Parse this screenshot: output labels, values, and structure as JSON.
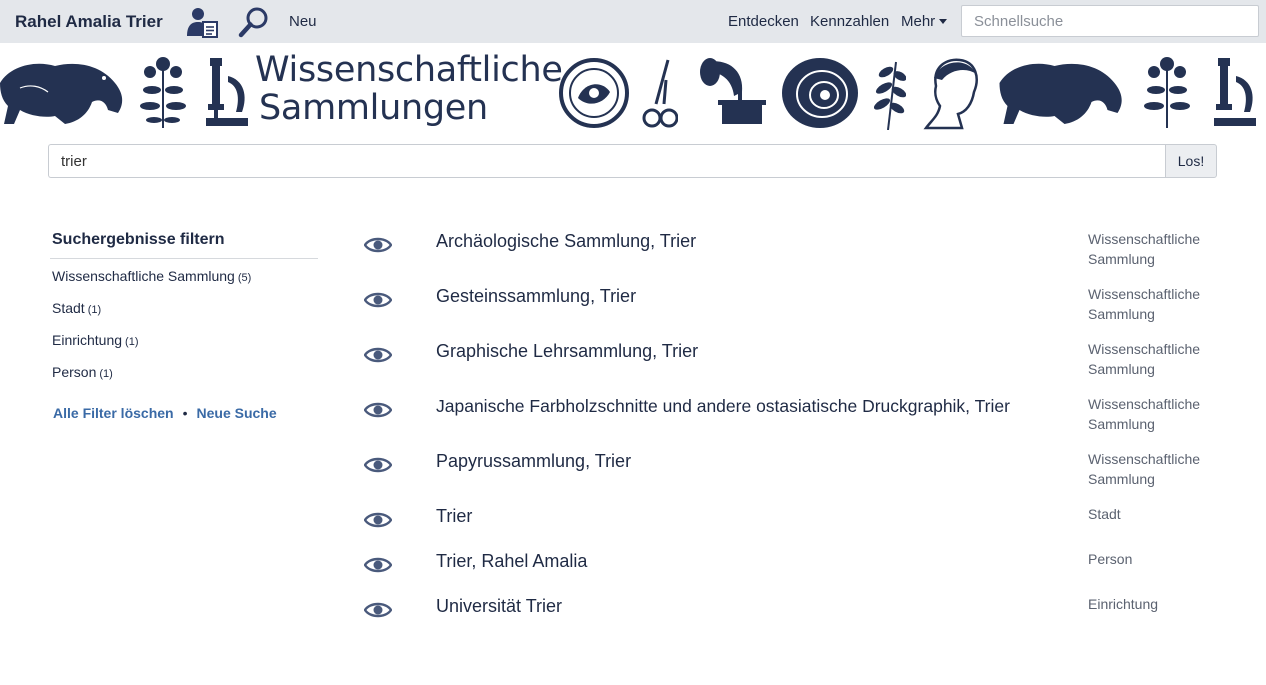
{
  "navbar": {
    "brand": "Rahel Amalia Trier",
    "neu": "Neu",
    "entdecken": "Entdecken",
    "kennzahlen": "Kennzahlen",
    "mehr": "Mehr",
    "quick_search_placeholder": "Schnellsuche"
  },
  "banner": {
    "title_line1": "Wissenschaftliche",
    "title_line2": "Sammlungen"
  },
  "search": {
    "value": "trier",
    "button": "Los!"
  },
  "sidebar": {
    "title": "Suchergebnisse filtern",
    "facets": [
      {
        "label": "Wissenschaftliche Sammlung",
        "count": "(5)"
      },
      {
        "label": "Stadt",
        "count": "(1)"
      },
      {
        "label": "Einrichtung",
        "count": "(1)"
      },
      {
        "label": "Person",
        "count": "(1)"
      }
    ],
    "clear_filters": "Alle Filter löschen",
    "separator": "•",
    "new_search": "Neue Suche"
  },
  "results": [
    {
      "title": "Archäologische Sammlung, Trier",
      "type": "Wissenschaftliche Sammlung"
    },
    {
      "title": "Gesteinssammlung, Trier",
      "type": "Wissenschaftliche Sammlung"
    },
    {
      "title": "Graphische Lehrsammlung, Trier",
      "type": "Wissenschaftliche Sammlung"
    },
    {
      "title": "Japanische Farbholzschnitte und andere ostasiatische Druckgraphik, Trier",
      "type": "Wissenschaftliche Sammlung"
    },
    {
      "title": "Papyrussammlung, Trier",
      "type": "Wissenschaftliche Sammlung"
    },
    {
      "title": "Trier",
      "type": "Stadt"
    },
    {
      "title": "Trier, Rahel Amalia",
      "type": "Person"
    },
    {
      "title": "Universität Trier",
      "type": "Einrichtung"
    }
  ],
  "colors": {
    "navy": "#1f2a44",
    "link": "#3a6aa6",
    "navbar_bg": "#e4e7eb",
    "eye": "#4a5a7c"
  },
  "icons": [
    "user-card-icon",
    "search-icon",
    "caret-down-icon",
    "eye-icon"
  ]
}
